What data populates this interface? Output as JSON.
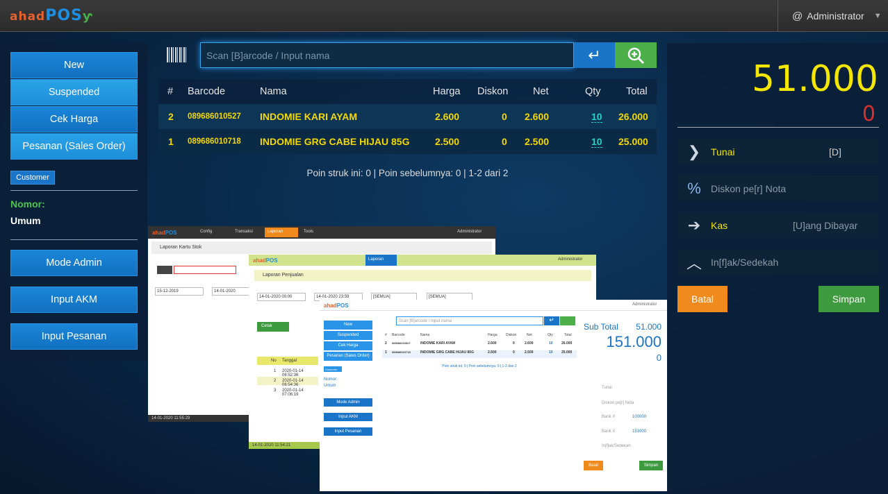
{
  "app": {
    "logo_ahad": "ahad",
    "logo_pos": "POS",
    "logo_mark": "ƴ",
    "user": "Administrator"
  },
  "left": {
    "new": "New",
    "suspended": "Suspended",
    "cek_harga": "Cek Harga",
    "pesanan": "Pesanan (Sales Order)",
    "customer": "Customer",
    "nomor_label": "Nomor:",
    "nomor_value": "Umum",
    "mode_admin": "Mode Admin",
    "input_akm": "Input AKM",
    "input_pesanan": "Input Pesanan"
  },
  "search": {
    "placeholder": "Scan [B]arcode / Input nama"
  },
  "table": {
    "headers": [
      "#",
      "Barcode",
      "Nama",
      "Harga",
      "Diskon",
      "Net",
      "Qty",
      "Total"
    ],
    "rows": [
      {
        "no": "2",
        "barcode": "089686010527",
        "nama": "INDOMIE KARI AYAM",
        "harga": "2.600",
        "diskon": "0",
        "net": "2.600",
        "qty": "10",
        "total": "26.000"
      },
      {
        "no": "1",
        "barcode": "089686010718",
        "nama": "INDOMIE GRG CABE HIJAU 85G",
        "harga": "2.500",
        "diskon": "0",
        "net": "2.500",
        "qty": "10",
        "total": "25.000"
      }
    ],
    "poin": "Poin struk ini: 0 | Poin sebelumnya: 0 | 1-2 dari 2"
  },
  "right": {
    "total": "51.000",
    "change": "0",
    "tunai": "Tunai",
    "tunai_hint": "[D]",
    "diskon_placeholder": "Diskon pe[r] Nota",
    "kas": "Kas",
    "kas_hint": "[U]ang Dibayar",
    "infak_placeholder": "In[f]ak/Sedekah",
    "batal": "Batal",
    "simpan": "Simpan"
  },
  "thumb1": {
    "title": "Laporan Kartu Stok",
    "menu": [
      "Config",
      "Transaksi",
      "Laporan",
      "Tools"
    ],
    "dari": "15-12-2019",
    "sampai": "14-01-2020",
    "footer": "14-01-2020 11:55:29"
  },
  "thumb2": {
    "title": "Laporan Penjualan",
    "dari": "14-01-2020 00:00",
    "sampai": "14-01-2020 23:59",
    "kategori": "[SEMUA]",
    "jenis": "[SEMUA]",
    "cetak": "Cetak",
    "col_no": "No",
    "col_tanggal": "Tanggal",
    "rows": [
      {
        "no": "1",
        "tanggal": "2020-01-14 06:52:36"
      },
      {
        "no": "2",
        "tanggal": "2020-01-14 06:54:36"
      },
      {
        "no": "3",
        "tanggal": "2020-01-14 07:06:19"
      }
    ],
    "footer": "14-01-2020 11:54:21"
  },
  "thumb3": {
    "sub_total_label": "Sub Total",
    "sub_total": "51.000",
    "grand": "151.000",
    "change": "0",
    "bank1": "Bank X",
    "bank1_val": "100000",
    "bank2": "Bank X",
    "bank2_val": "151000",
    "batal": "Batal",
    "simpan": "Simpan"
  }
}
